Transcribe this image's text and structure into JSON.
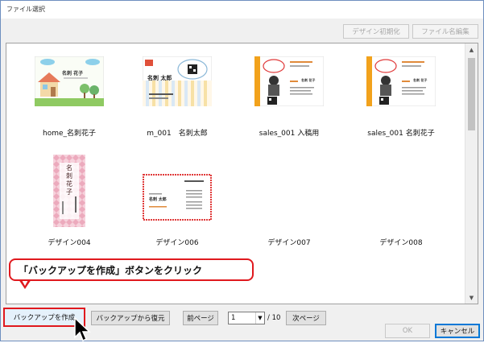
{
  "window": {
    "title": "ファイル選択"
  },
  "toolbar": {
    "design_init_label": "デザイン初期化",
    "file_rename_label": "ファイル名編集"
  },
  "cards": [
    {
      "label": "home_名刺花子",
      "thumb_name": "名刺 花子"
    },
    {
      "label": "m_001　名刺太郎",
      "thumb_name": "名刺 太郎"
    },
    {
      "label": "sales_001 入稿用",
      "thumb_name": "名刺 花子"
    },
    {
      "label": "sales_001 名刺花子",
      "thumb_name": "名刺 花子"
    },
    {
      "label": "デザイン004",
      "thumb_name": "名刺 花子"
    },
    {
      "label": "デザイン006",
      "thumb_name": "名刺 太郎"
    },
    {
      "label": "デザイン007"
    },
    {
      "label": "デザイン008"
    }
  ],
  "callout": {
    "text": "「バックアップを作成」ボタンをクリック"
  },
  "footer": {
    "backup_create_label": "バックアップを作成",
    "backup_restore_label": "バックアップから復元",
    "prev_page_label": "前ページ",
    "page_value": "1",
    "page_total": "/ 10",
    "next_page_label": "次ページ",
    "ok_label": "OK",
    "cancel_label": "キャンセル"
  },
  "icons": {
    "dropdown": "chevron-down-icon",
    "scroll_up": "chevron-up-icon",
    "scroll_down": "chevron-down-icon",
    "cursor": "mouse-pointer-icon"
  },
  "colors": {
    "callout_border": "#e0191e",
    "highlight_border": "#e0191e",
    "accent_blue": "#0078d7"
  }
}
